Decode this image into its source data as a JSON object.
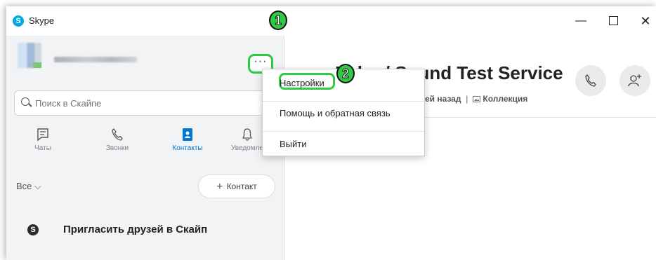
{
  "window": {
    "title": "Skype",
    "logo_letter": "S",
    "minimize_icon": "—",
    "close_icon": "✕"
  },
  "sidebar": {
    "more_button": "···",
    "search": {
      "placeholder": "Поиск в Скайпе",
      "more": "⁝"
    },
    "tabs": [
      {
        "label": "Чаты",
        "icon": "chat-icon"
      },
      {
        "label": "Звонки",
        "icon": "phone-icon"
      },
      {
        "label": "Контакты",
        "icon": "contacts-icon",
        "active": true
      },
      {
        "label": "Уведомле",
        "icon": "bell-icon"
      }
    ],
    "filter": "Все ⌵",
    "add_contact": {
      "plus": "+",
      "label": "Контакт"
    },
    "invite": {
      "icon_letter": "S",
      "label": "Пригласить друзей в Скайп"
    }
  },
  "main": {
    "chat_title": "Echo / Sound Test Service",
    "subtitle_time": "ей назад",
    "subtitle_sep": "|",
    "subtitle_collection": "Коллекция"
  },
  "menu": {
    "items": [
      {
        "label": "Настройки"
      },
      {
        "label": "Помощь и обратная связь"
      },
      {
        "label": "Выйти"
      }
    ]
  },
  "annotations": {
    "step1": "1",
    "step2": "2"
  },
  "colors": {
    "accent": "#0078d4",
    "highlight": "#2ecc40",
    "skype_blue": "#00a9e6"
  }
}
